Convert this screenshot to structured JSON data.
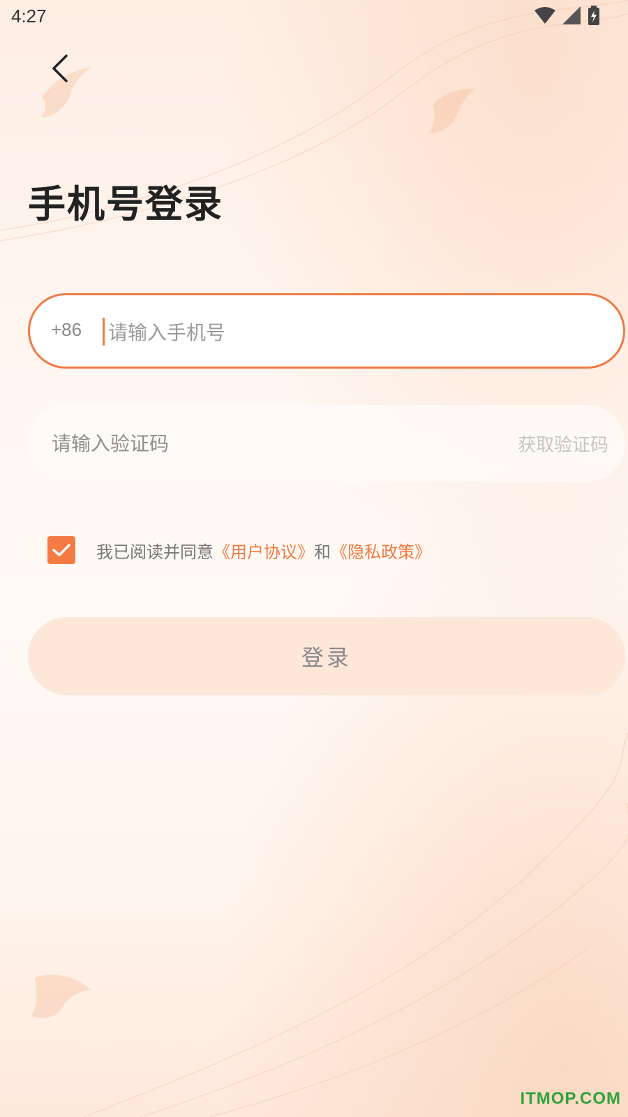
{
  "status_bar": {
    "time": "4:27"
  },
  "header": {
    "back_icon": "chevron-left-icon"
  },
  "page": {
    "title": "手机号登录"
  },
  "phone": {
    "country_code": "+86",
    "placeholder": "请输入手机号",
    "value": ""
  },
  "code": {
    "placeholder": "请输入验证码",
    "value": "",
    "get_code_label": "获取验证码"
  },
  "agreement": {
    "checked": true,
    "prefix": "我已阅读并同意",
    "user_agreement": "《用户协议》",
    "conjunction": "和",
    "privacy_policy": "《隐私政策》"
  },
  "login": {
    "label": "登录"
  },
  "watermark": "ITMOP.COM",
  "colors": {
    "accent": "#f07a45",
    "button_bg": "#fde7d9",
    "watermark": "#2fa33a"
  }
}
